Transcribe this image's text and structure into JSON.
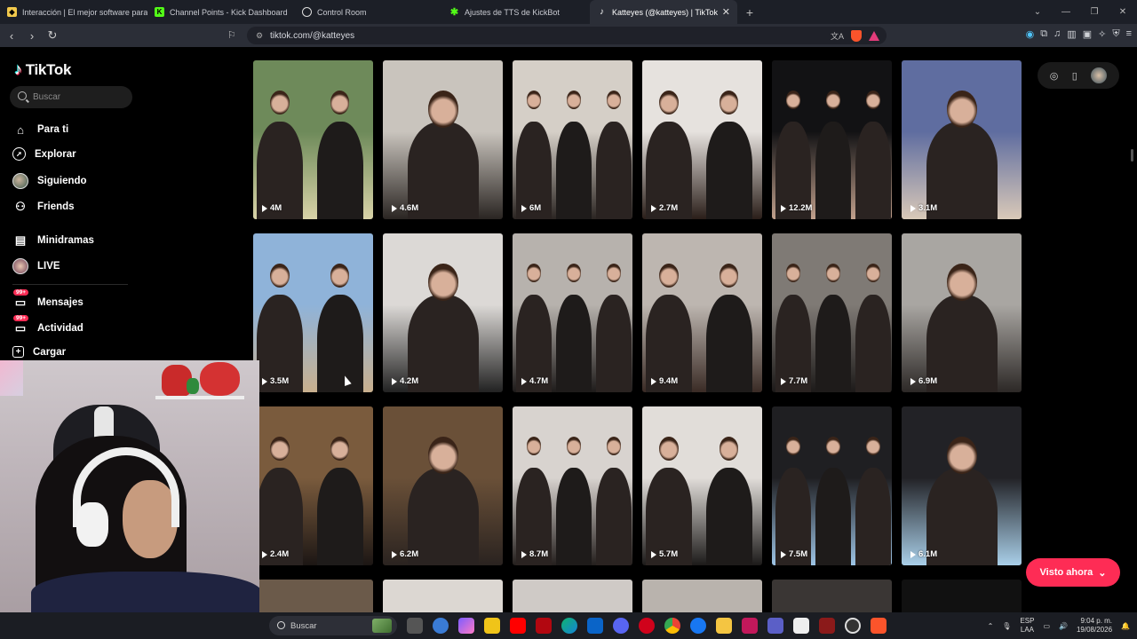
{
  "browser": {
    "tabs": [
      {
        "title": "Interacción | El mejor software para p",
        "fav_color": "#f2c94c"
      },
      {
        "title": "Channel Points - Kick Dashboard",
        "fav_color": "#53fc18"
      },
      {
        "title": "Control Room",
        "fav_color": "#ffffff"
      },
      {
        "title": "Ajustes de TTS de KickBot",
        "fav_color": "#53fc18"
      },
      {
        "title": "Katteyes (@katteyes) | TikTok",
        "fav_color": "#ffffff",
        "active": true
      }
    ],
    "url": "tiktok.com/@katteyes"
  },
  "tiktok": {
    "logo_text": "TikTok",
    "search_placeholder": "Buscar",
    "nav": [
      {
        "label": "Para ti",
        "icon": "home-icon"
      },
      {
        "label": "Explorar",
        "icon": "compass-icon"
      },
      {
        "label": "Siguiendo",
        "icon": "avatar-icon"
      },
      {
        "label": "Friends",
        "icon": "friends-icon"
      },
      {
        "label": "Minidramas",
        "icon": "film-icon"
      },
      {
        "label": "LIVE",
        "icon": "live-icon"
      },
      {
        "label": "Mensajes",
        "icon": "message-icon",
        "badge": "99+"
      },
      {
        "label": "Actividad",
        "icon": "bell-icon",
        "badge": "99+"
      },
      {
        "label": "Cargar",
        "icon": "upload-icon"
      }
    ],
    "videos": [
      {
        "views": "4M"
      },
      {
        "views": "4.6M"
      },
      {
        "views": "6M"
      },
      {
        "views": "2.7M"
      },
      {
        "views": "12.2M"
      },
      {
        "views": "3.1M"
      },
      {
        "views": "3.5M"
      },
      {
        "views": "4.2M"
      },
      {
        "views": "4.7M"
      },
      {
        "views": "9.4M"
      },
      {
        "views": "7.7M"
      },
      {
        "views": "6.9M"
      },
      {
        "views": "2.4M"
      },
      {
        "views": "6.2M"
      },
      {
        "views": "8.7M"
      },
      {
        "views": "5.7M"
      },
      {
        "views": "7.5M"
      },
      {
        "views": "6.1M"
      }
    ],
    "visto_ahora": "Visto ahora"
  },
  "taskbar": {
    "search_placeholder": "Buscar",
    "lang_top": "ESP",
    "lang_bottom": "LAA",
    "time": "9:04 p. m.",
    "date": "19/08/2026"
  },
  "colors": {
    "accent": "#fe2c55",
    "tab_active": "#2b2e37",
    "tab_strip": "#1c1f27"
  }
}
